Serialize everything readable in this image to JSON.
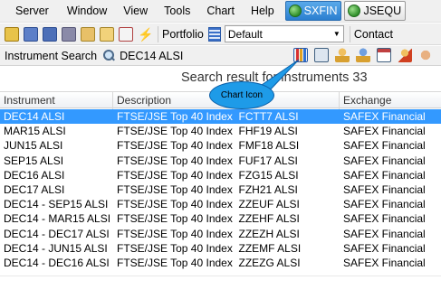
{
  "menubar": {
    "items": [
      "Server",
      "Window",
      "View",
      "Tools",
      "Chart",
      "Help"
    ],
    "tabs": [
      {
        "label": "SXFIN",
        "active": true
      },
      {
        "label": "JSEQU",
        "active": false
      }
    ]
  },
  "toolbar": {
    "icons": [
      "lock-icon",
      "book-icon",
      "book-delete-icon",
      "stack-icon",
      "notepad-icon",
      "notepad-alt-icon",
      "document-icon",
      "lightning-icon"
    ],
    "portfolio_label": "Portfolio",
    "portfolio_icon": "grid-icon",
    "portfolio_selected": "Default",
    "contact_label": "Contact"
  },
  "search": {
    "label": "Instrument Search",
    "value": "DEC14 ALSI",
    "result_heading": "Search result for instruments 33",
    "right_icons": [
      "chart-icon",
      "copy-icon",
      "person-add-icon",
      "person-group-icon",
      "calendar-icon",
      "person-edit-icon",
      "handshake-icon"
    ]
  },
  "callout": {
    "text": "Chart Icon",
    "color": "#1e9be8"
  },
  "table": {
    "headers": {
      "instrument": "Instrument",
      "description": "Description",
      "exchange": "Exchange"
    },
    "rows": [
      {
        "instrument": "DEC14 ALSI",
        "description": "FTSE/JSE Top 40 Index  FCTT7 ALSI",
        "exchange": "SAFEX Financial",
        "selected": true
      },
      {
        "instrument": "MAR15 ALSI",
        "description": "FTSE/JSE Top 40 Index  FHF19 ALSI",
        "exchange": "SAFEX Financial",
        "selected": false
      },
      {
        "instrument": "JUN15 ALSI",
        "description": "FTSE/JSE Top 40 Index  FMF18 ALSI",
        "exchange": "SAFEX Financial",
        "selected": false
      },
      {
        "instrument": "SEP15 ALSI",
        "description": "FTSE/JSE Top 40 Index  FUF17 ALSI",
        "exchange": "SAFEX Financial",
        "selected": false
      },
      {
        "instrument": "DEC16 ALSI",
        "description": "FTSE/JSE Top 40 Index  FZG15 ALSI",
        "exchange": "SAFEX Financial",
        "selected": false
      },
      {
        "instrument": "DEC17 ALSI",
        "description": "FTSE/JSE Top 40 Index  FZH21 ALSI",
        "exchange": "SAFEX Financial",
        "selected": false
      },
      {
        "instrument": "DEC14 - SEP15 ALSI",
        "description": "FTSE/JSE Top 40 Index  ZZEUF ALSI",
        "exchange": "SAFEX Financial",
        "selected": false
      },
      {
        "instrument": "DEC14 - MAR15 ALSI",
        "description": "FTSE/JSE Top 40 Index  ZZEHF ALSI",
        "exchange": "SAFEX Financial",
        "selected": false
      },
      {
        "instrument": "DEC14 - DEC17 ALSI",
        "description": "FTSE/JSE Top 40 Index  ZZEZH ALSI",
        "exchange": "SAFEX Financial",
        "selected": false
      },
      {
        "instrument": "DEC14 - JUN15 ALSI",
        "description": "FTSE/JSE Top 40 Index  ZZEMF ALSI",
        "exchange": "SAFEX Financial",
        "selected": false
      },
      {
        "instrument": "DEC14 - DEC16 ALSI",
        "description": "FTSE/JSE Top 40 Index  ZZEZG ALSI",
        "exchange": "SAFEX Financial",
        "selected": false
      }
    ]
  },
  "colors": {
    "selected_row": "#3399ff",
    "active_tab": "#2a7fd0"
  }
}
